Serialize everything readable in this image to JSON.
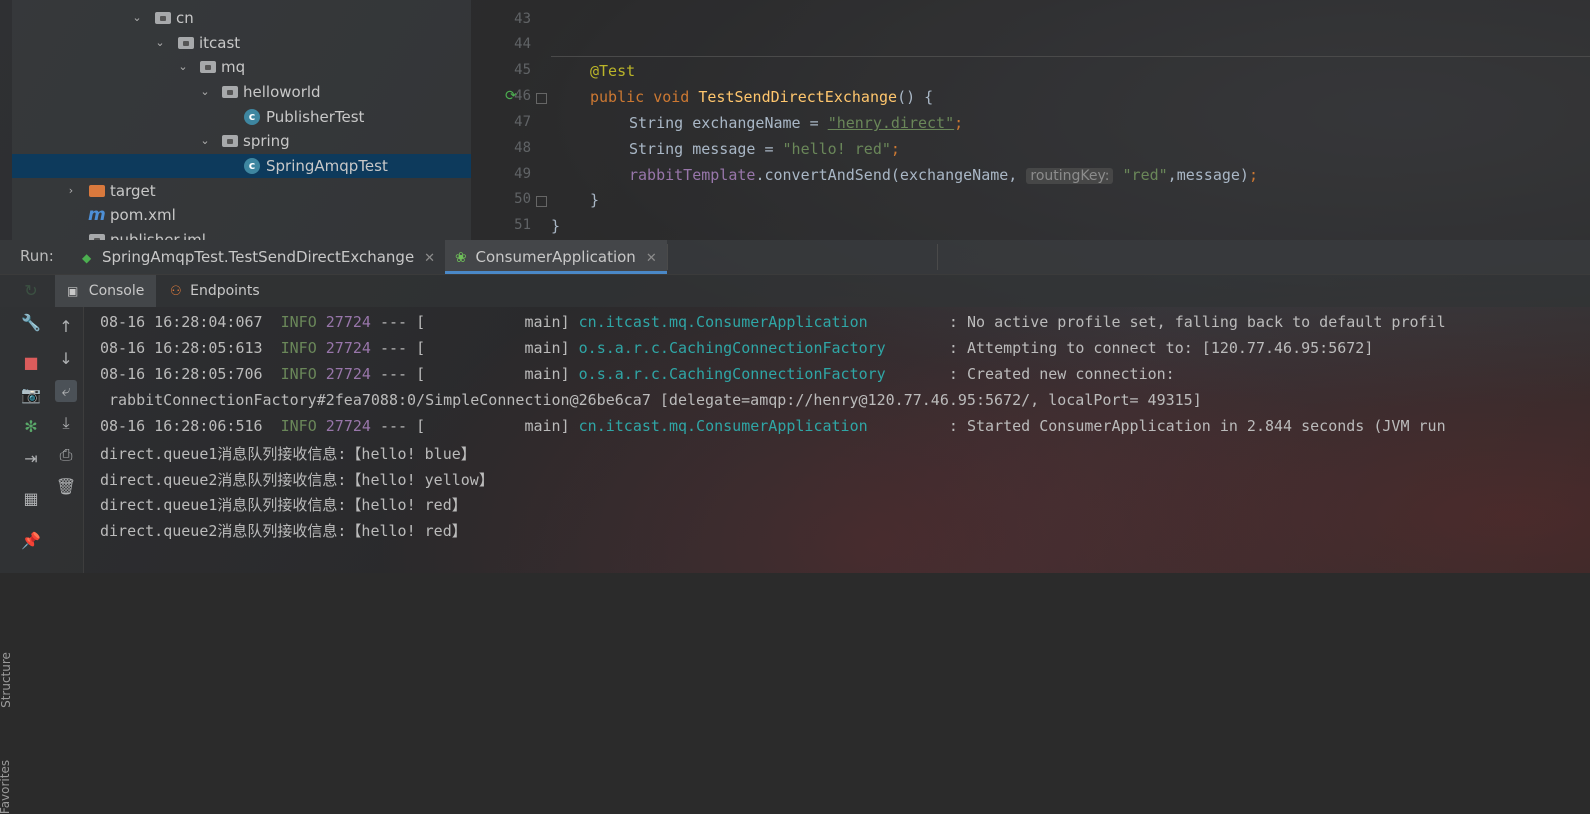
{
  "tree": {
    "items": [
      {
        "label": "cn",
        "type": "package"
      },
      {
        "label": "itcast",
        "type": "package"
      },
      {
        "label": "mq",
        "type": "package"
      },
      {
        "label": "helloworld",
        "type": "package"
      },
      {
        "label": "PublisherTest",
        "type": "class"
      },
      {
        "label": "spring",
        "type": "package"
      },
      {
        "label": "SpringAmqpTest",
        "type": "class",
        "selected": true
      },
      {
        "label": "target",
        "type": "folder"
      },
      {
        "label": "pom.xml",
        "type": "maven"
      },
      {
        "label": "publisher.iml",
        "type": "file"
      }
    ]
  },
  "editor": {
    "line_numbers": [
      "43",
      "44",
      "45",
      "46",
      "47",
      "48",
      "49",
      "50",
      "51"
    ],
    "code": {
      "l45_annotation": "@Test",
      "l46_public": "public",
      "l46_void": "void",
      "l46_method": "TestSendDirectExchange",
      "l46_rest": "() {",
      "l47_type": "String exchangeName = ",
      "l47_value": "\"henry.direct\"",
      "l47_end": ";",
      "l48_type": "String message = ",
      "l48_value": "\"hello! red\"",
      "l48_end": ";",
      "l49_field": "rabbitTemplate",
      "l49_call": ".convertAndSend(exchangeName,",
      "l49_hint": "routingKey:",
      "l49_arg": "\"red\"",
      "l49_end": ",message)",
      "l49_semicolon": ";",
      "l50": "}",
      "l51": "}"
    }
  },
  "runbar": {
    "label": "Run:",
    "tabs": [
      {
        "label": "SpringAmqpTest.TestSendDirectExchange"
      },
      {
        "label": "ConsumerApplication",
        "active": true
      }
    ]
  },
  "console_tabs": [
    {
      "label": "Console",
      "active": true
    },
    {
      "label": "Endpoints"
    }
  ],
  "side_labels": {
    "structure": "Structure",
    "favorites": "Favorites"
  },
  "console": {
    "log_lines": [
      {
        "ts": "08-16 16:28:04:067",
        "level": "INFO",
        "pid": "27724",
        "thread": "--- [           main]",
        "logger": "cn.itcast.mq.ConsumerApplication",
        "msg": ": No active profile set, falling back to default profil"
      },
      {
        "ts": "08-16 16:28:05:613",
        "level": "INFO",
        "pid": "27724",
        "thread": "--- [           main]",
        "logger": "o.s.a.r.c.CachingConnectionFactory",
        "msg": ": Attempting to connect to: [120.77.46.95:5672]"
      },
      {
        "ts": "08-16 16:28:05:706",
        "level": "INFO",
        "pid": "27724",
        "thread": "--- [           main]",
        "logger": "o.s.a.r.c.CachingConnectionFactory",
        "msg": ": Created new connection:"
      }
    ],
    "continuation": "rabbitConnectionFactory#2fea7088:0/SimpleConnection@26be6ca7 [delegate=amqp://henry@120.77.46.95:5672/, localPort= 49315]",
    "log_line4": {
      "ts": "08-16 16:28:06:516",
      "level": "INFO",
      "pid": "27724",
      "thread": "--- [           main]",
      "logger": "cn.itcast.mq.ConsumerApplication",
      "msg": ": Started ConsumerApplication in 2.844 seconds (JVM run"
    },
    "messages": [
      "direct.queue1消息队列接收信息:【hello! blue】",
      "direct.queue2消息队列接收信息:【hello! yellow】",
      "direct.queue1消息队列接收信息:【hello! red】",
      "direct.queue2消息队列接收信息:【hello! red】"
    ]
  },
  "colors": {
    "selection": "#0d3a5c",
    "keyword": "#cc7832",
    "string": "#6a8759",
    "annotation": "#bbb529",
    "method": "#ffc66d",
    "logger": "#2fa6a6"
  }
}
